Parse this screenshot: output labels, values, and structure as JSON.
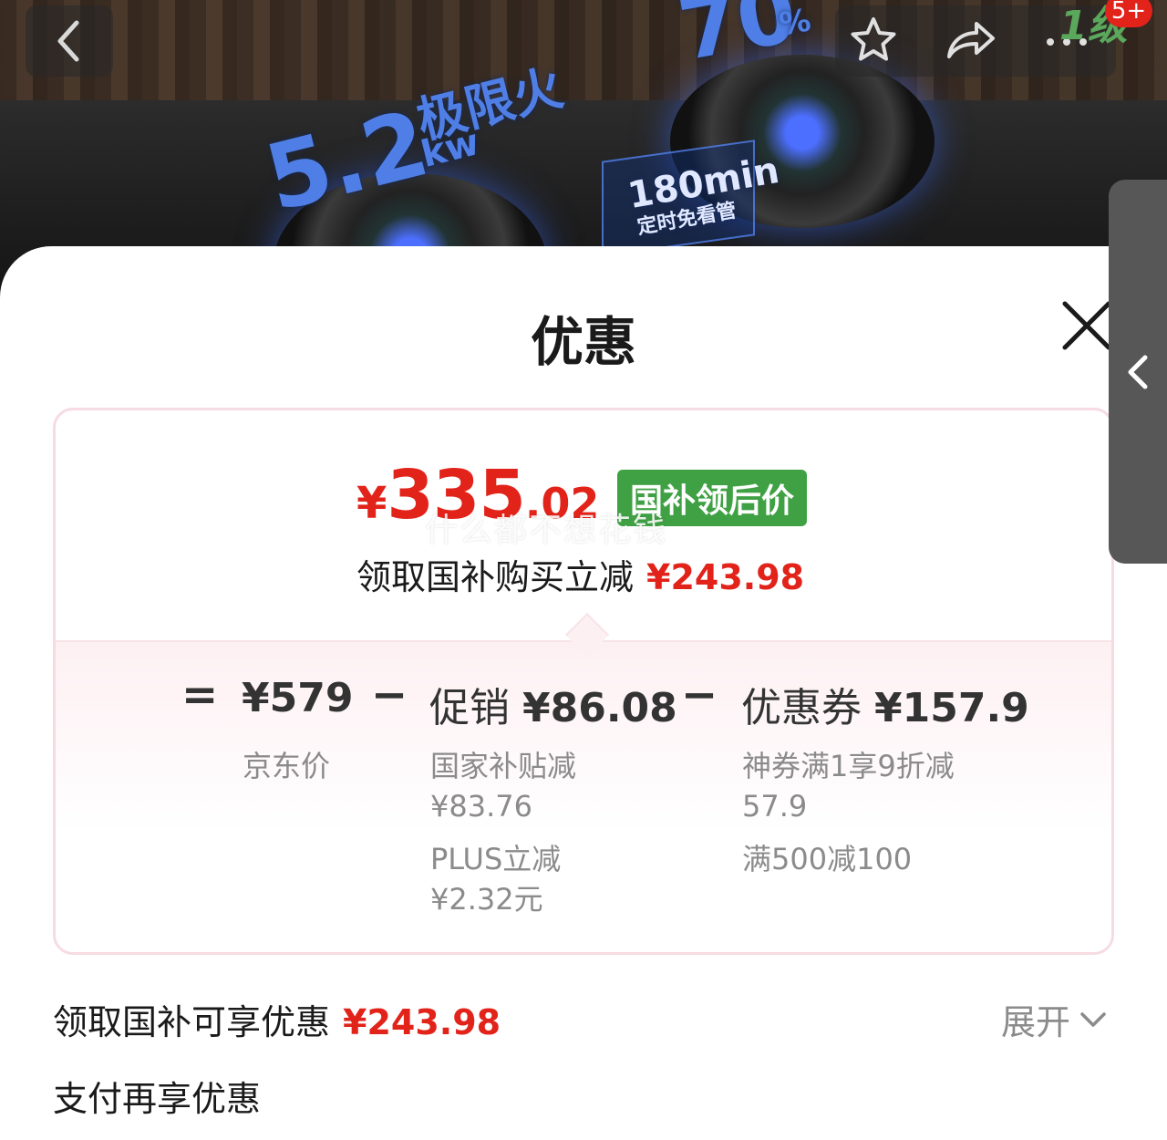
{
  "hero": {
    "power_value": "5.2",
    "power_unit": "kw",
    "power_label": "极限火",
    "percent_value": "70",
    "percent_sign": "%",
    "timer_value": "180min",
    "timer_label": "定时免看管",
    "energy_badge": "1级",
    "notification_count": "5+"
  },
  "sheet": {
    "title": "优惠"
  },
  "summary": {
    "final_symbol": "¥",
    "final_integer": "335",
    "final_decimal": ".02",
    "final_tag": "国补领后价",
    "watermark": "什么都不想花钱",
    "save_label": "领取国补购买立减",
    "save_amount": "¥243.98"
  },
  "breakdown": {
    "equals": "=",
    "minus": "−",
    "base": {
      "value": "¥579",
      "label": "京东价"
    },
    "promo": {
      "title": "促销",
      "value": "¥86.08",
      "items": [
        {
          "line1": "国家补贴减",
          "line2": "¥83.76"
        },
        {
          "line1": "PLUS立减",
          "line2": "¥2.32元"
        }
      ]
    },
    "coupon": {
      "title": "优惠券",
      "value": "¥157.9",
      "items": [
        {
          "line1": "神券满1享9折减",
          "line2": "57.9"
        },
        {
          "line1": "满500减100",
          "line2": ""
        }
      ]
    }
  },
  "rows": {
    "subsidy_label": "领取国补可享优惠",
    "subsidy_amount": "¥243.98",
    "expand_label": "展开",
    "payment_label": "支付再享优惠"
  },
  "colors": {
    "accent_red": "#e2231a",
    "tag_green": "#3fa144",
    "card_border": "#f6dbe2"
  }
}
